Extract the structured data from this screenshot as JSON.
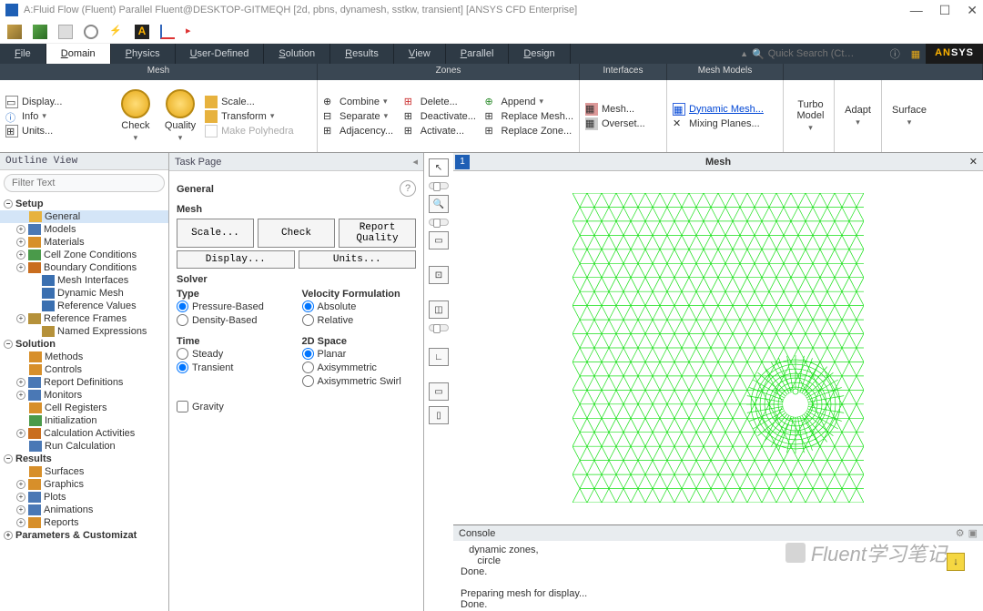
{
  "title": "A:Fluid Flow (Fluent) Parallel Fluent@DESKTOP-GITMEQH  [2d, pbns, dynamesh, sstkw, transient] [ANSYS CFD Enterprise]",
  "menutabs": [
    "File",
    "Domain",
    "Physics",
    "User-Defined",
    "Solution",
    "Results",
    "View",
    "Parallel",
    "Design"
  ],
  "active_tab": "Domain",
  "search_placeholder": "Quick Search (Ct…",
  "ansys_brand": "ANSYS",
  "ribbon": {
    "headers": [
      "Mesh",
      "Zones",
      "Interfaces",
      "Mesh Models",
      ""
    ],
    "mesh": {
      "display": "Display...",
      "info": "Info",
      "units": "Units...",
      "check": "Check",
      "quality": "Quality",
      "scale": "Scale...",
      "transform": "Transform",
      "make_poly": "Make Polyhedra"
    },
    "zones": {
      "combine": "Combine",
      "separate": "Separate",
      "adjacency": "Adjacency...",
      "delete": "Delete...",
      "deactivate": "Deactivate...",
      "activate": "Activate...",
      "append": "Append",
      "replace_mesh": "Replace Mesh...",
      "replace_zone": "Replace Zone..."
    },
    "interfaces": {
      "mesh": "Mesh...",
      "overset": "Overset..."
    },
    "mesh_models": {
      "dynamic": "Dynamic Mesh...",
      "mixing": "Mixing Planes..."
    },
    "right": {
      "turbo": "Turbo Model",
      "adapt": "Adapt",
      "surface": "Surface"
    }
  },
  "outline": {
    "title": "Outline View",
    "filter_ph": "Filter Text",
    "nodes": [
      {
        "d": 0,
        "exp": "-",
        "label": "Setup",
        "bold": true
      },
      {
        "d": 1,
        "i": "gen",
        "label": "General",
        "sel": true
      },
      {
        "d": 1,
        "exp": "+",
        "i": "mod",
        "label": "Models"
      },
      {
        "d": 1,
        "exp": "+",
        "i": "mat",
        "label": "Materials"
      },
      {
        "d": 1,
        "exp": "+",
        "i": "cz",
        "label": "Cell Zone Conditions"
      },
      {
        "d": 1,
        "exp": "+",
        "i": "bc",
        "label": "Boundary Conditions"
      },
      {
        "d": 2,
        "i": "mi",
        "label": "Mesh Interfaces"
      },
      {
        "d": 2,
        "i": "dm",
        "label": "Dynamic Mesh"
      },
      {
        "d": 2,
        "i": "rv",
        "label": "Reference Values"
      },
      {
        "d": 1,
        "exp": "+",
        "i": "rf",
        "label": "Reference Frames"
      },
      {
        "d": 2,
        "i": "ne",
        "label": "Named Expressions"
      },
      {
        "d": 0,
        "exp": "-",
        "label": "Solution",
        "bold": true
      },
      {
        "d": 1,
        "i": "me",
        "label": "Methods"
      },
      {
        "d": 1,
        "i": "ct",
        "label": "Controls"
      },
      {
        "d": 1,
        "exp": "+",
        "i": "rd",
        "label": "Report Definitions"
      },
      {
        "d": 1,
        "exp": "+",
        "i": "mo",
        "label": "Monitors"
      },
      {
        "d": 1,
        "i": "cr",
        "label": "Cell Registers"
      },
      {
        "d": 1,
        "i": "in",
        "label": "Initialization"
      },
      {
        "d": 1,
        "exp": "+",
        "i": "ca",
        "label": "Calculation Activities"
      },
      {
        "d": 1,
        "i": "rc",
        "label": "Run Calculation"
      },
      {
        "d": 0,
        "exp": "-",
        "label": "Results",
        "bold": true
      },
      {
        "d": 1,
        "i": "su",
        "label": "Surfaces"
      },
      {
        "d": 1,
        "exp": "+",
        "i": "gr",
        "label": "Graphics"
      },
      {
        "d": 1,
        "exp": "+",
        "i": "pl",
        "label": "Plots"
      },
      {
        "d": 1,
        "exp": "+",
        "i": "an",
        "label": "Animations"
      },
      {
        "d": 1,
        "exp": "+",
        "i": "re",
        "label": "Reports"
      },
      {
        "d": 0,
        "exp": "+",
        "label": "Parameters & Customizat",
        "bold": true
      }
    ]
  },
  "taskpage": {
    "title": "Task Page",
    "general": "General",
    "mesh_lbl": "Mesh",
    "btns1": [
      "Scale...",
      "Check",
      "Report Quality"
    ],
    "btns2": [
      "Display...",
      "Units..."
    ],
    "solver": "Solver",
    "type_lbl": "Type",
    "type_opts": [
      "Pressure-Based",
      "Density-Based"
    ],
    "type_sel": "Pressure-Based",
    "vel_lbl": "Velocity Formulation",
    "vel_opts": [
      "Absolute",
      "Relative"
    ],
    "vel_sel": "Absolute",
    "time_lbl": "Time",
    "time_opts": [
      "Steady",
      "Transient"
    ],
    "time_sel": "Transient",
    "space_lbl": "2D Space",
    "space_opts": [
      "Planar",
      "Axisymmetric",
      "Axisymmetric Swirl"
    ],
    "space_sel": "Planar",
    "gravity": "Gravity"
  },
  "canvas": {
    "title": "Mesh"
  },
  "console": {
    "title": "Console",
    "text": "   dynamic zones,\n      circle\nDone.\n\nPreparing mesh for display...\nDone."
  },
  "watermark": "Fluent学习笔记",
  "icon_colors": {
    "gen": "#e7b23e",
    "mod": "#4a78b5",
    "mat": "#d78f2a",
    "cz": "#4a9a4a",
    "bc": "#c96d1e",
    "mi": "#3a6fb0",
    "dm": "#3a6fb0",
    "rv": "#3a6fb0",
    "rf": "#b5913a",
    "ne": "#b5913a",
    "me": "#d78f2a",
    "ct": "#d78f2a",
    "rd": "#4a78b5",
    "mo": "#4a78b5",
    "cr": "#d78f2a",
    "in": "#4a9a4a",
    "ca": "#c96d1e",
    "rc": "#4a78b5",
    "su": "#d78f2a",
    "gr": "#d78f2a",
    "pl": "#4a78b5",
    "an": "#4a78b5",
    "re": "#d78f2a"
  }
}
